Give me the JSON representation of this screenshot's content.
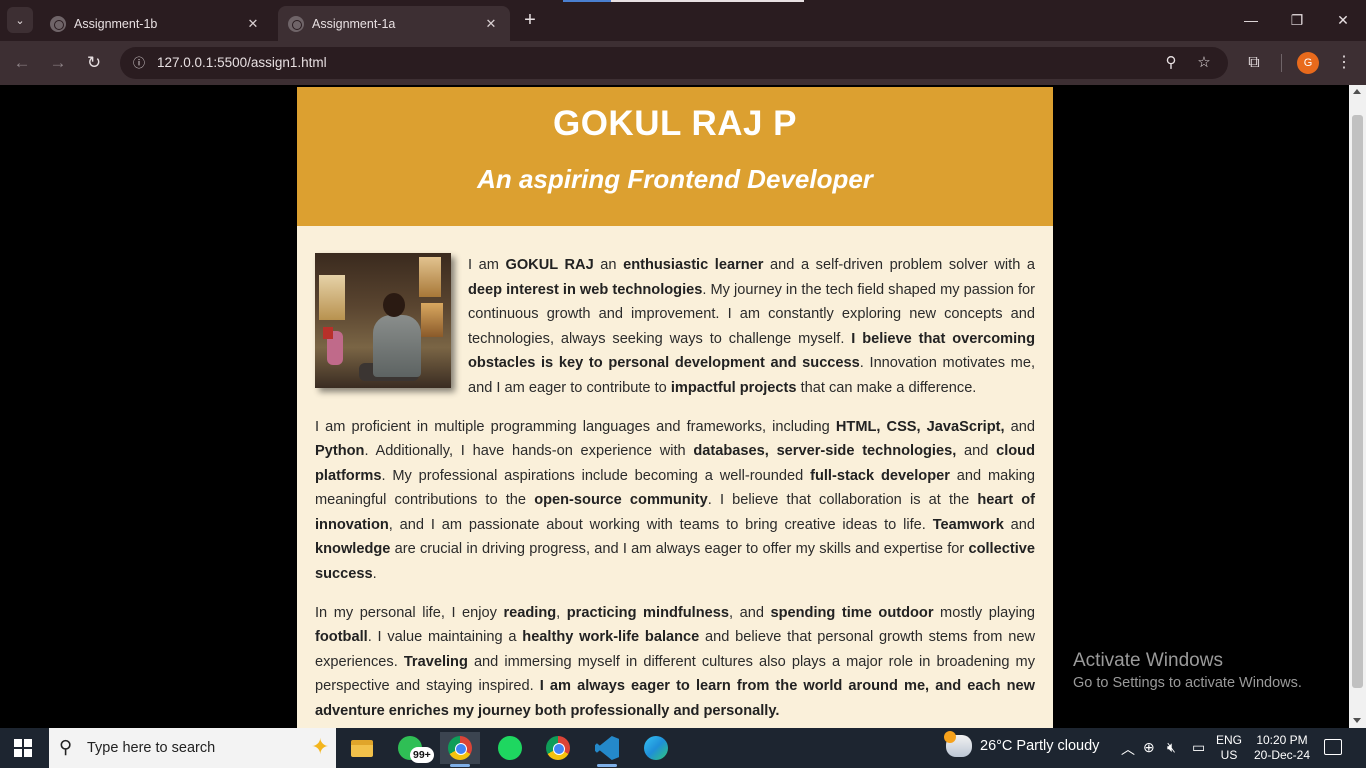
{
  "browser": {
    "tabs": [
      {
        "title": "Assignment-1b",
        "active": false
      },
      {
        "title": "Assignment-1a",
        "active": true
      }
    ],
    "url_host": "127.0.0.1",
    "url_path": ":5500/assign1.html",
    "profile_initial": "G"
  },
  "page": {
    "name": "GOKUL RAJ P",
    "tagline": "An aspiring Frontend Developer",
    "paragraphs": [
      [
        {
          "t": "I am "
        },
        {
          "t": "GOKUL RAJ",
          "b": true
        },
        {
          "t": " an "
        },
        {
          "t": "enthusiastic learner",
          "b": true
        },
        {
          "t": " and a self-driven problem solver with a "
        },
        {
          "t": "deep interest in web technologies",
          "b": true
        },
        {
          "t": ". My journey in the tech field shaped my passion for continuous growth and improvement. I am constantly exploring new concepts and technologies, always seeking ways to challenge myself. "
        },
        {
          "t": "I believe that overcoming obstacles is key to personal development and success",
          "b": true
        },
        {
          "t": ". Innovation motivates me, and I am eager to contribute to "
        },
        {
          "t": "impactful projects",
          "b": true
        },
        {
          "t": " that can make a difference."
        }
      ],
      [
        {
          "t": "I am proficient in multiple programming languages and frameworks, including "
        },
        {
          "t": "HTML, CSS, JavaScript,",
          "b": true
        },
        {
          "t": " and "
        },
        {
          "t": "Python",
          "b": true
        },
        {
          "t": ". Additionally, I have hands-on experience with "
        },
        {
          "t": "databases, server-side technologies,",
          "b": true
        },
        {
          "t": " and "
        },
        {
          "t": "cloud platforms",
          "b": true
        },
        {
          "t": ". My professional aspirations include becoming a well-rounded "
        },
        {
          "t": "full-stack developer",
          "b": true
        },
        {
          "t": " and making meaningful contributions to the "
        },
        {
          "t": "open-source community",
          "b": true
        },
        {
          "t": ". I believe that collaboration is at the "
        },
        {
          "t": "heart of innovation",
          "b": true
        },
        {
          "t": ", and I am passionate about working with teams to bring creative ideas to life. "
        },
        {
          "t": "Teamwork",
          "b": true
        },
        {
          "t": " and "
        },
        {
          "t": "knowledge",
          "b": true
        },
        {
          "t": " are crucial in driving progress, and I am always eager to offer my skills and expertise for "
        },
        {
          "t": "collective success",
          "b": true
        },
        {
          "t": "."
        }
      ],
      [
        {
          "t": "In my personal life, I enjoy "
        },
        {
          "t": "reading",
          "b": true
        },
        {
          "t": ", "
        },
        {
          "t": "practicing mindfulness",
          "b": true
        },
        {
          "t": ", and "
        },
        {
          "t": "spending time outdoor",
          "b": true
        },
        {
          "t": " mostly playing "
        },
        {
          "t": "football",
          "b": true
        },
        {
          "t": ". I value maintaining a "
        },
        {
          "t": "healthy work-life balance",
          "b": true
        },
        {
          "t": " and believe that personal growth stems from new experiences. "
        },
        {
          "t": "Traveling",
          "b": true
        },
        {
          "t": " and immersing myself in different cultures also plays a major role in broadening my perspective and staying inspired. "
        },
        {
          "t": "I am always eager to learn from the world around me, and each new adventure enriches my journey both professionally and personally.",
          "b": true
        }
      ]
    ]
  },
  "watermark": {
    "line1": "Activate Windows",
    "line2": "Go to Settings to activate Windows."
  },
  "taskbar": {
    "search_placeholder": "Type here to search",
    "whatsapp_badge": "99+",
    "weather": "26°C  Partly cloudy",
    "lang_line1": "ENG",
    "lang_line2": "US",
    "time": "10:20 PM",
    "date": "20-Dec-24"
  },
  "colors": {
    "header_bg": "#dca030",
    "page_bg": "#faf0da",
    "chrome_frame": "#2a1c20",
    "toolbar": "#3d2f33"
  }
}
